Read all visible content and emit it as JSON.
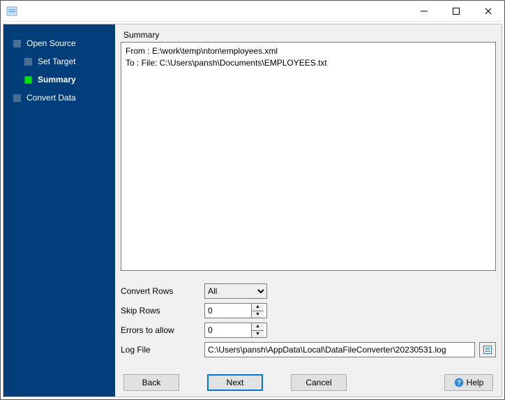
{
  "window_title": "",
  "sidebar": {
    "steps": [
      {
        "label": "Open Source",
        "sub": false
      },
      {
        "label": "Set Target",
        "sub": true
      },
      {
        "label": "Summary",
        "sub": true,
        "current": true
      },
      {
        "label": "Convert Data",
        "sub": false
      }
    ]
  },
  "summary": {
    "heading": "Summary",
    "line_from": "From : E:\\work\\temp\\nton\\employees.xml",
    "line_to": "To : File: C:\\Users\\pansh\\Documents\\EMPLOYEES.txt"
  },
  "form": {
    "convert_rows_label": "Convert Rows",
    "convert_rows_value": "All",
    "skip_rows_label": "Skip Rows",
    "skip_rows_value": "0",
    "errors_label": "Errors to allow",
    "errors_value": "0",
    "logfile_label": "Log File",
    "logfile_value": "C:\\Users\\pansh\\AppData\\Local\\DataFileConverter\\20230531.log"
  },
  "buttons": {
    "back": "Back",
    "next": "Next",
    "cancel": "Cancel",
    "help": "Help"
  }
}
